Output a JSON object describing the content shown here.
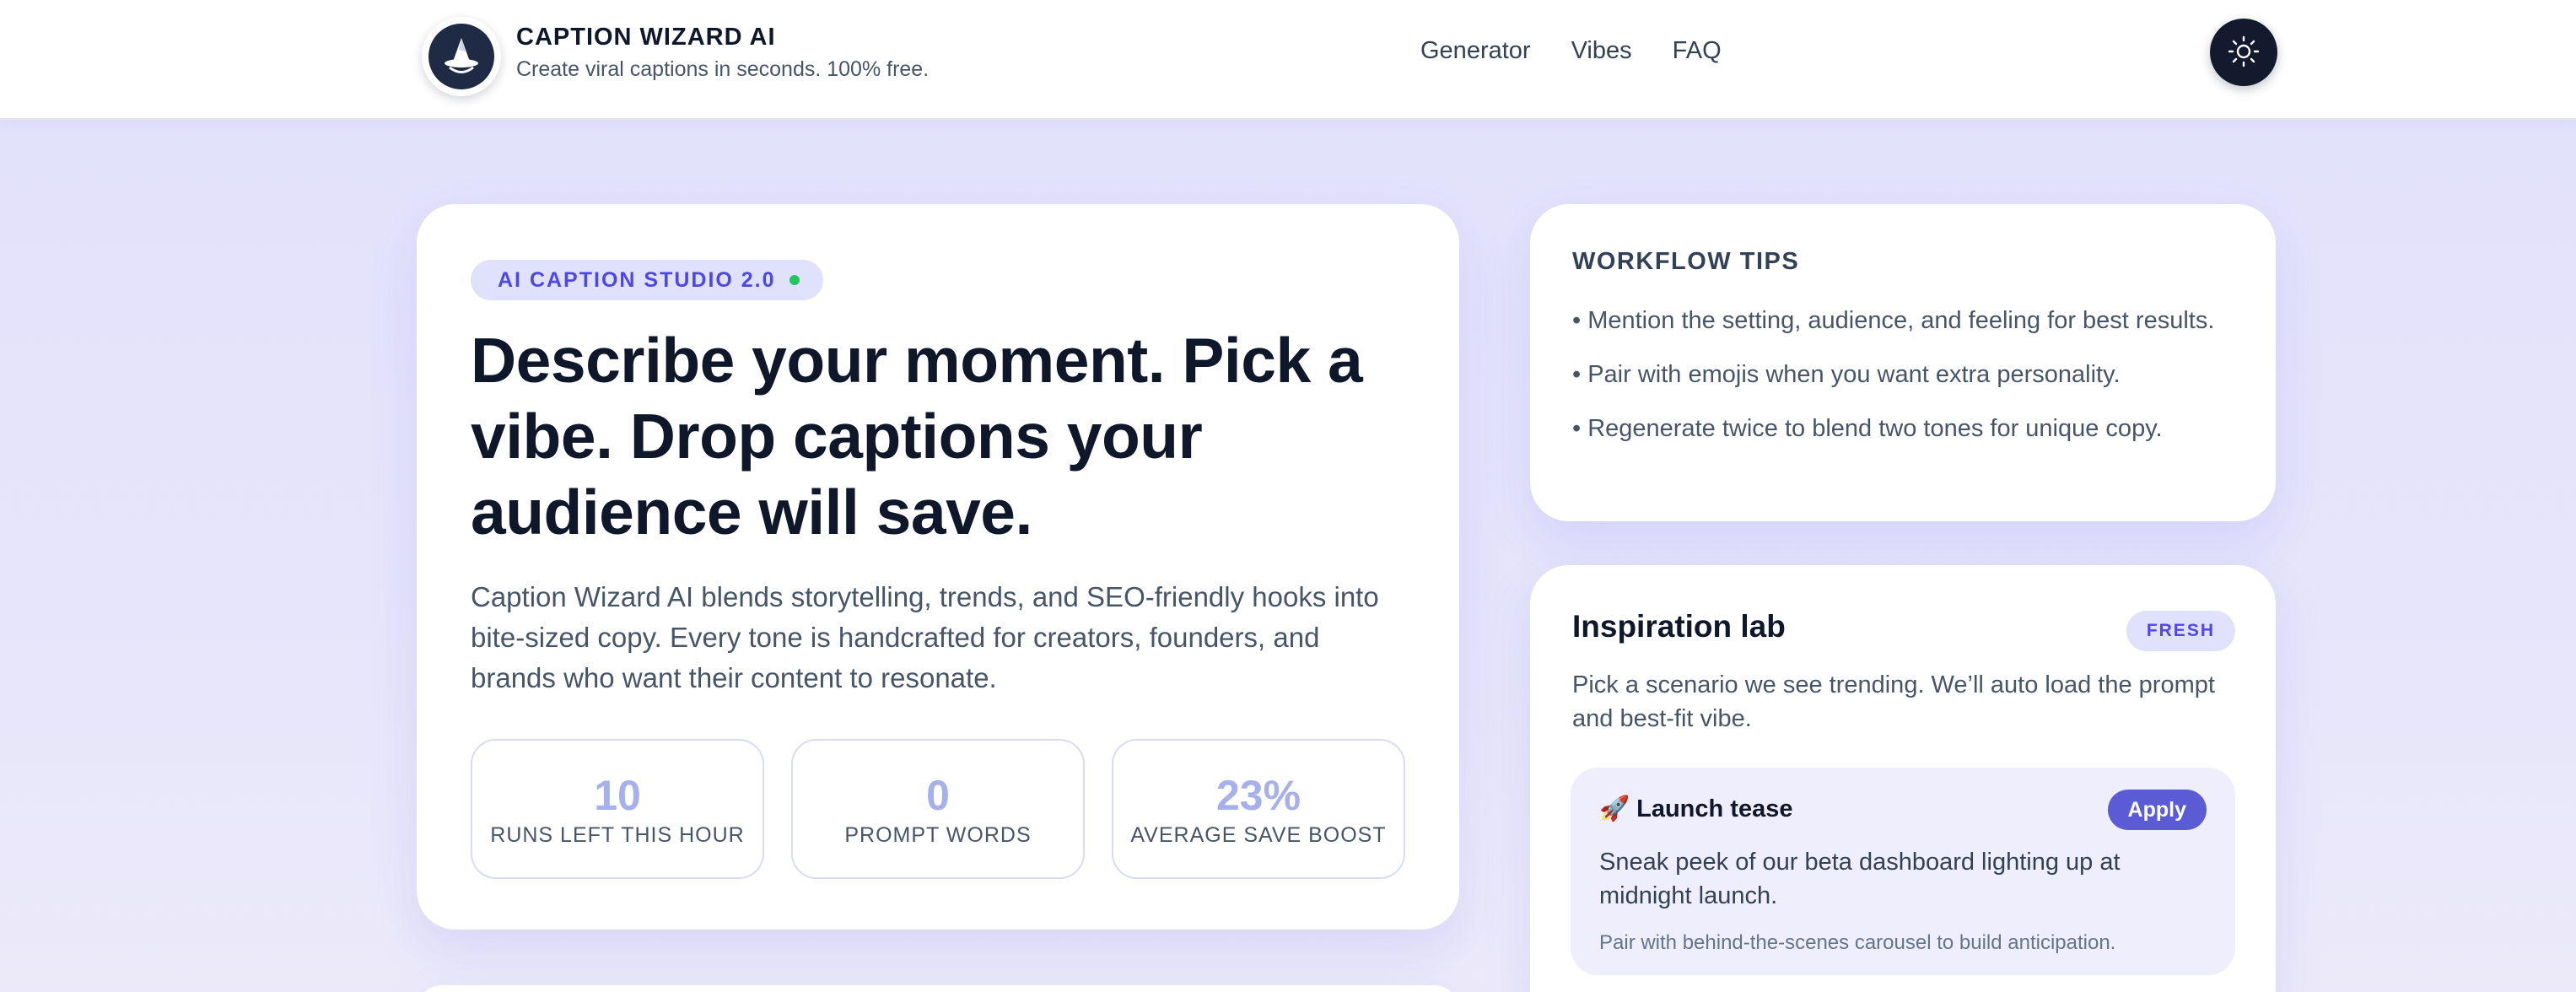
{
  "header": {
    "title": "CAPTION WIZARD AI",
    "subtitle": "Create viral captions in seconds. 100% free.",
    "logo_icon": "wizard-hat-icon",
    "nav": [
      {
        "label": "Generator"
      },
      {
        "label": "Vibes"
      },
      {
        "label": "FAQ"
      }
    ],
    "theme_toggle_icon": "sun-icon"
  },
  "hero": {
    "badge": "AI CAPTION STUDIO 2.0",
    "heading": "Describe your moment. Pick a vibe. Drop captions your audience will save.",
    "lead": "Caption Wizard AI blends storytelling, trends, and SEO-friendly hooks into bite-sized copy. Every tone is handcrafted for creators, founders, and brands who want their content to resonate.",
    "stats": [
      {
        "value": "10",
        "label": "RUNS LEFT THIS HOUR"
      },
      {
        "value": "0",
        "label": "PROMPT WORDS"
      },
      {
        "value": "23%",
        "label": "AVERAGE SAVE BOOST"
      }
    ]
  },
  "tips": {
    "title": "WORKFLOW TIPS",
    "items": [
      "• Mention the setting, audience, and feeling for best results.",
      "• Pair with emojis when you want extra personality.",
      "• Regenerate twice to blend two tones for unique copy."
    ]
  },
  "lab": {
    "title": "Inspiration lab",
    "tag": "FRESH",
    "description": "Pick a scenario we see trending. We’ll auto load the prompt and best-fit vibe.",
    "scenario": {
      "emoji": "🚀",
      "title": "Launch tease",
      "apply_label": "Apply",
      "body": "Sneak peek of our beta dashboard lighting up at midnight launch.",
      "note": "Pair with behind-the-scenes carousel to build anticipation."
    }
  },
  "colors": {
    "accent": "#5b5bd6",
    "badge_bg": "#e0e1fb",
    "status_dot": "#22c55e",
    "stat_number": "#a5b0ec",
    "page_bg": "#e2e1fb"
  }
}
